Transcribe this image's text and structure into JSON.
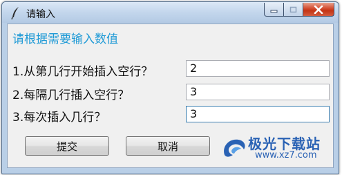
{
  "window": {
    "title": "请输入",
    "icons": {
      "app": "feather-pen-icon",
      "minimize": "minimize-icon",
      "maximize": "maximize-icon",
      "close": "close-icon"
    }
  },
  "form": {
    "prompt": "请根据需要输入数值",
    "fields": [
      {
        "label": "1.从第几行开始插入空行？",
        "value": "2"
      },
      {
        "label": "2.每隔几行插入空行？",
        "value": "3"
      },
      {
        "label": "3.每次插入几行？",
        "value": "3"
      }
    ]
  },
  "buttons": {
    "submit": "提交",
    "cancel": "取消"
  },
  "watermark": {
    "brand": "极光下载站",
    "url": "www.xz7.com"
  },
  "colors": {
    "prompt": "#1f9ad6",
    "close": "#c43414",
    "brand": "#2a62b4"
  }
}
